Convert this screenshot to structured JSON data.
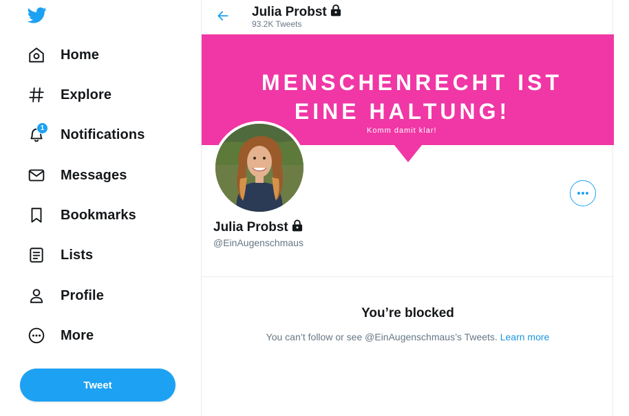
{
  "sidebar": {
    "logo_icon": "twitter-bird-icon",
    "items": [
      {
        "label": "Home",
        "icon": "home-icon"
      },
      {
        "label": "Explore",
        "icon": "hashtag-icon"
      },
      {
        "label": "Notifications",
        "icon": "bell-icon",
        "badge": "1"
      },
      {
        "label": "Messages",
        "icon": "envelope-icon"
      },
      {
        "label": "Bookmarks",
        "icon": "bookmark-icon"
      },
      {
        "label": "Lists",
        "icon": "list-icon"
      },
      {
        "label": "Profile",
        "icon": "person-icon"
      },
      {
        "label": "More",
        "icon": "more-circle-icon"
      }
    ],
    "tweet_button": "Tweet"
  },
  "header": {
    "name": "Julia Probst",
    "tweet_count": "93.2K Tweets"
  },
  "banner": {
    "line1": "MENSCHENRECHT IST",
    "line2": "EINE HALTUNG!",
    "subtext": "Komm damit klar!"
  },
  "profile": {
    "name": "Julia Probst",
    "handle": "@EinAugenschmaus"
  },
  "blocked": {
    "title": "You’re blocked",
    "message": "You can’t follow or see @EinAugenschmaus’s Tweets.",
    "link": "Learn more"
  },
  "colors": {
    "accent": "#1da1f2",
    "banner": "#f037a5",
    "text": "#14171a",
    "muted": "#657786"
  }
}
